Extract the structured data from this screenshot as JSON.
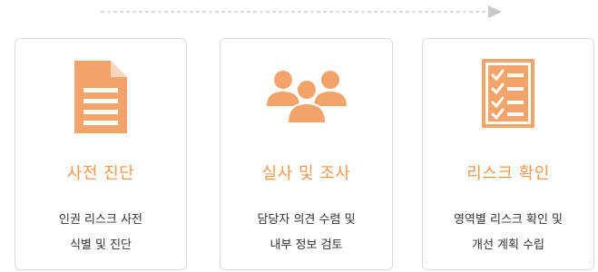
{
  "accent_color": "#f2a46a",
  "steps": [
    {
      "icon": "document-icon",
      "title": "사전 진단",
      "desc": [
        "인권 리스크 사전",
        "식별 및 진단"
      ]
    },
    {
      "icon": "group-users-icon",
      "title": "실사 및 조사",
      "desc": [
        "담당자 의견 수렴 및",
        "내부 정보 검토"
      ]
    },
    {
      "icon": "checklist-icon",
      "title": "리스크 확인",
      "desc": [
        "영역별 리스크 확인 및",
        "개선 계획 수립"
      ]
    }
  ]
}
